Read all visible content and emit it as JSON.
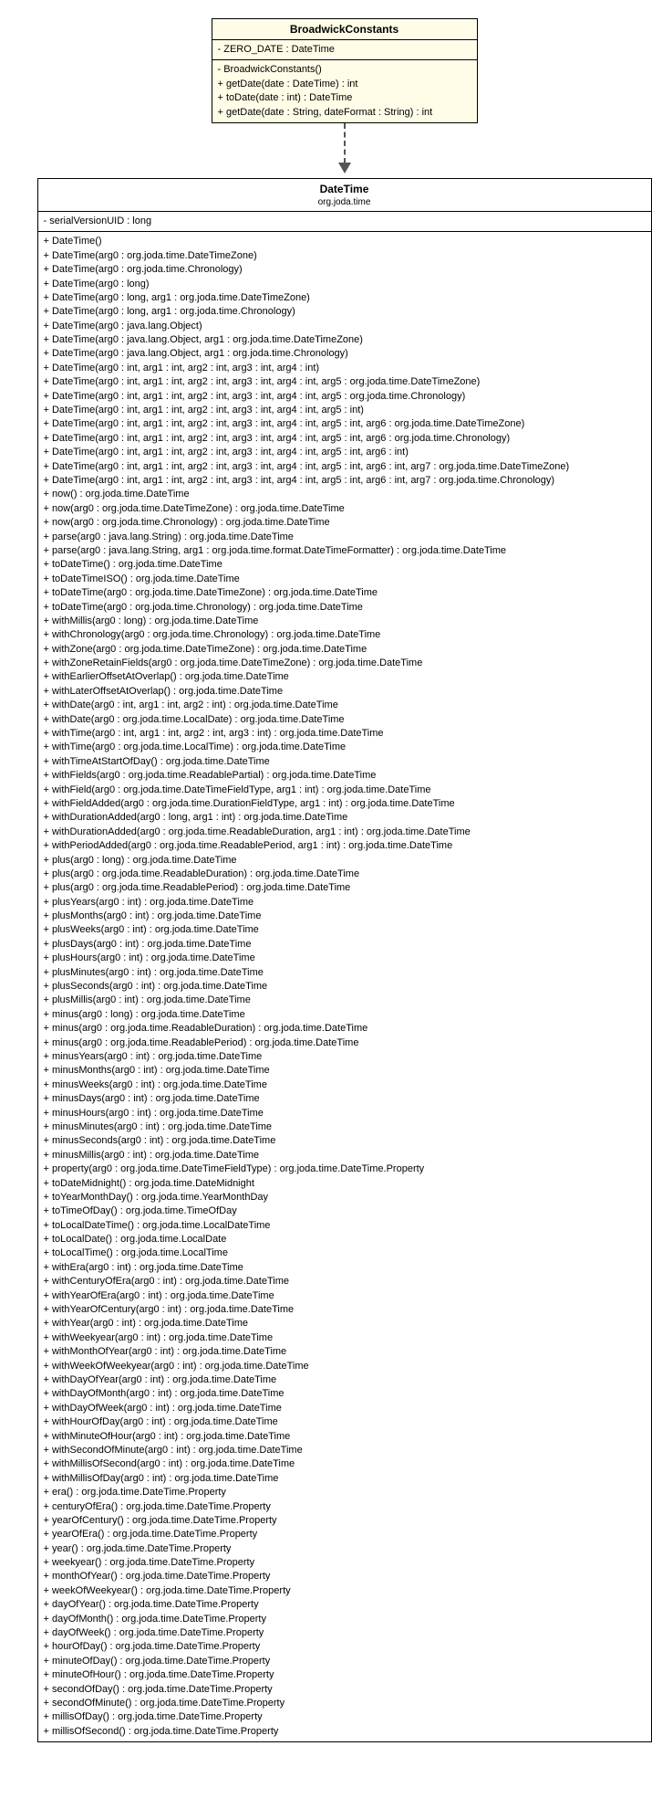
{
  "top_class": {
    "name": "BroadwickConstants",
    "fields": [
      "- ZERO_DATE : DateTime"
    ],
    "methods": [
      "- BroadwickConstants()",
      "+ getDate(date : DateTime) : int",
      "+ toDate(date : int) : DateTime",
      "+ getDate(date : String, dateFormat : String) : int"
    ]
  },
  "bottom_class": {
    "name": "DateTime",
    "package": "org.joda.time",
    "fields": [
      "- serialVersionUID : long"
    ],
    "methods": [
      "+ DateTime()",
      "+ DateTime(arg0 : org.joda.time.DateTimeZone)",
      "+ DateTime(arg0 : org.joda.time.Chronology)",
      "+ DateTime(arg0 : long)",
      "+ DateTime(arg0 : long, arg1 : org.joda.time.DateTimeZone)",
      "+ DateTime(arg0 : long, arg1 : org.joda.time.Chronology)",
      "+ DateTime(arg0 : java.lang.Object)",
      "+ DateTime(arg0 : java.lang.Object, arg1 : org.joda.time.DateTimeZone)",
      "+ DateTime(arg0 : java.lang.Object, arg1 : org.joda.time.Chronology)",
      "+ DateTime(arg0 : int, arg1 : int, arg2 : int, arg3 : int, arg4 : int)",
      "+ DateTime(arg0 : int, arg1 : int, arg2 : int, arg3 : int, arg4 : int, arg5 : org.joda.time.DateTimeZone)",
      "+ DateTime(arg0 : int, arg1 : int, arg2 : int, arg3 : int, arg4 : int, arg5 : org.joda.time.Chronology)",
      "+ DateTime(arg0 : int, arg1 : int, arg2 : int, arg3 : int, arg4 : int, arg5 : int)",
      "+ DateTime(arg0 : int, arg1 : int, arg2 : int, arg3 : int, arg4 : int, arg5 : int, arg6 : org.joda.time.DateTimeZone)",
      "+ DateTime(arg0 : int, arg1 : int, arg2 : int, arg3 : int, arg4 : int, arg5 : int, arg6 : org.joda.time.Chronology)",
      "+ DateTime(arg0 : int, arg1 : int, arg2 : int, arg3 : int, arg4 : int, arg5 : int, arg6 : int)",
      "+ DateTime(arg0 : int, arg1 : int, arg2 : int, arg3 : int, arg4 : int, arg5 : int, arg6 : int, arg7 : org.joda.time.DateTimeZone)",
      "+ DateTime(arg0 : int, arg1 : int, arg2 : int, arg3 : int, arg4 : int, arg5 : int, arg6 : int, arg7 : org.joda.time.Chronology)",
      "+ now() : org.joda.time.DateTime",
      "+ now(arg0 : org.joda.time.DateTimeZone) : org.joda.time.DateTime",
      "+ now(arg0 : org.joda.time.Chronology) : org.joda.time.DateTime",
      "+ parse(arg0 : java.lang.String) : org.joda.time.DateTime",
      "+ parse(arg0 : java.lang.String, arg1 : org.joda.time.format.DateTimeFormatter) : org.joda.time.DateTime",
      "+ toDateTime() : org.joda.time.DateTime",
      "+ toDateTimeISO() : org.joda.time.DateTime",
      "+ toDateTime(arg0 : org.joda.time.DateTimeZone) : org.joda.time.DateTime",
      "+ toDateTime(arg0 : org.joda.time.Chronology) : org.joda.time.DateTime",
      "+ withMillis(arg0 : long) : org.joda.time.DateTime",
      "+ withChronology(arg0 : org.joda.time.Chronology) : org.joda.time.DateTime",
      "+ withZone(arg0 : org.joda.time.DateTimeZone) : org.joda.time.DateTime",
      "+ withZoneRetainFields(arg0 : org.joda.time.DateTimeZone) : org.joda.time.DateTime",
      "+ withEarlierOffsetAtOverlap() : org.joda.time.DateTime",
      "+ withLaterOffsetAtOverlap() : org.joda.time.DateTime",
      "+ withDate(arg0 : int, arg1 : int, arg2 : int) : org.joda.time.DateTime",
      "+ withDate(arg0 : org.joda.time.LocalDate) : org.joda.time.DateTime",
      "+ withTime(arg0 : int, arg1 : int, arg2 : int, arg3 : int) : org.joda.time.DateTime",
      "+ withTime(arg0 : org.joda.time.LocalTime) : org.joda.time.DateTime",
      "+ withTimeAtStartOfDay() : org.joda.time.DateTime",
      "+ withFields(arg0 : org.joda.time.ReadablePartial) : org.joda.time.DateTime",
      "+ withField(arg0 : org.joda.time.DateTimeFieldType, arg1 : int) : org.joda.time.DateTime",
      "+ withFieldAdded(arg0 : org.joda.time.DurationFieldType, arg1 : int) : org.joda.time.DateTime",
      "+ withDurationAdded(arg0 : long, arg1 : int) : org.joda.time.DateTime",
      "+ withDurationAdded(arg0 : org.joda.time.ReadableDuration, arg1 : int) : org.joda.time.DateTime",
      "+ withPeriodAdded(arg0 : org.joda.time.ReadablePeriod, arg1 : int) : org.joda.time.DateTime",
      "+ plus(arg0 : long) : org.joda.time.DateTime",
      "+ plus(arg0 : org.joda.time.ReadableDuration) : org.joda.time.DateTime",
      "+ plus(arg0 : org.joda.time.ReadablePeriod) : org.joda.time.DateTime",
      "+ plusYears(arg0 : int) : org.joda.time.DateTime",
      "+ plusMonths(arg0 : int) : org.joda.time.DateTime",
      "+ plusWeeks(arg0 : int) : org.joda.time.DateTime",
      "+ plusDays(arg0 : int) : org.joda.time.DateTime",
      "+ plusHours(arg0 : int) : org.joda.time.DateTime",
      "+ plusMinutes(arg0 : int) : org.joda.time.DateTime",
      "+ plusSeconds(arg0 : int) : org.joda.time.DateTime",
      "+ plusMillis(arg0 : int) : org.joda.time.DateTime",
      "+ minus(arg0 : long) : org.joda.time.DateTime",
      "+ minus(arg0 : org.joda.time.ReadableDuration) : org.joda.time.DateTime",
      "+ minus(arg0 : org.joda.time.ReadablePeriod) : org.joda.time.DateTime",
      "+ minusYears(arg0 : int) : org.joda.time.DateTime",
      "+ minusMonths(arg0 : int) : org.joda.time.DateTime",
      "+ minusWeeks(arg0 : int) : org.joda.time.DateTime",
      "+ minusDays(arg0 : int) : org.joda.time.DateTime",
      "+ minusHours(arg0 : int) : org.joda.time.DateTime",
      "+ minusMinutes(arg0 : int) : org.joda.time.DateTime",
      "+ minusSeconds(arg0 : int) : org.joda.time.DateTime",
      "+ minusMillis(arg0 : int) : org.joda.time.DateTime",
      "+ property(arg0 : org.joda.time.DateTimeFieldType) : org.joda.time.DateTime.Property",
      "+ toDateMidnight() : org.joda.time.DateMidnight",
      "+ toYearMonthDay() : org.joda.time.YearMonthDay",
      "+ toTimeOfDay() : org.joda.time.TimeOfDay",
      "+ toLocalDateTime() : org.joda.time.LocalDateTime",
      "+ toLocalDate() : org.joda.time.LocalDate",
      "+ toLocalTime() : org.joda.time.LocalTime",
      "+ withEra(arg0 : int) : org.joda.time.DateTime",
      "+ withCenturyOfEra(arg0 : int) : org.joda.time.DateTime",
      "+ withYearOfEra(arg0 : int) : org.joda.time.DateTime",
      "+ withYearOfCentury(arg0 : int) : org.joda.time.DateTime",
      "+ withYear(arg0 : int) : org.joda.time.DateTime",
      "+ withWeekyear(arg0 : int) : org.joda.time.DateTime",
      "+ withMonthOfYear(arg0 : int) : org.joda.time.DateTime",
      "+ withWeekOfWeekyear(arg0 : int) : org.joda.time.DateTime",
      "+ withDayOfYear(arg0 : int) : org.joda.time.DateTime",
      "+ withDayOfMonth(arg0 : int) : org.joda.time.DateTime",
      "+ withDayOfWeek(arg0 : int) : org.joda.time.DateTime",
      "+ withHourOfDay(arg0 : int) : org.joda.time.DateTime",
      "+ withMinuteOfHour(arg0 : int) : org.joda.time.DateTime",
      "+ withSecondOfMinute(arg0 : int) : org.joda.time.DateTime",
      "+ withMillisOfSecond(arg0 : int) : org.joda.time.DateTime",
      "+ withMillisOfDay(arg0 : int) : org.joda.time.DateTime",
      "+ era() : org.joda.time.DateTime.Property",
      "+ centuryOfEra() : org.joda.time.DateTime.Property",
      "+ yearOfCentury() : org.joda.time.DateTime.Property",
      "+ yearOfEra() : org.joda.time.DateTime.Property",
      "+ year() : org.joda.time.DateTime.Property",
      "+ weekyear() : org.joda.time.DateTime.Property",
      "+ monthOfYear() : org.joda.time.DateTime.Property",
      "+ weekOfWeekyear() : org.joda.time.DateTime.Property",
      "+ dayOfYear() : org.joda.time.DateTime.Property",
      "+ dayOfMonth() : org.joda.time.DateTime.Property",
      "+ dayOfWeek() : org.joda.time.DateTime.Property",
      "+ hourOfDay() : org.joda.time.DateTime.Property",
      "+ minuteOfDay() : org.joda.time.DateTime.Property",
      "+ minuteOfHour() : org.joda.time.DateTime.Property",
      "+ secondOfDay() : org.joda.time.DateTime.Property",
      "+ secondOfMinute() : org.joda.time.DateTime.Property",
      "+ millisOfDay() : org.joda.time.DateTime.Property",
      "+ millisOfSecond() : org.joda.time.DateTime.Property"
    ]
  }
}
